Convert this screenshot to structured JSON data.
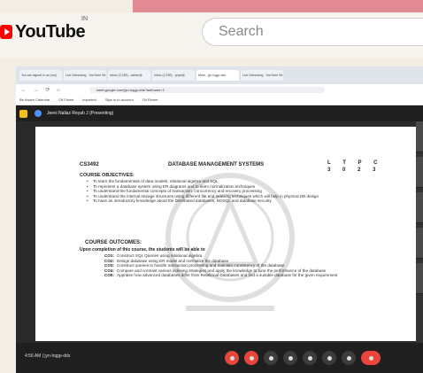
{
  "youtube": {
    "wordmark": "YouTube",
    "country": "IN",
    "search_placeholder": "Search"
  },
  "browser": {
    "tabs": [
      "You are signed in as (not)",
      "Live Streaming - YouTube Str",
      "Inbox (2,189) - admin@",
      "Inbox (2,189) - priya@",
      "Meet - jyn-hqgp-dds",
      "Live Streaming - YouTube Str"
    ],
    "active_tab_index": 4,
    "url": "meet.google.com/jyn-hqgp-dds?authuser=1",
    "bookmarks": [
      "Be Aware Calendar",
      "Oil Flowe",
      "Imported",
      "Sign in to account",
      "Oil Flower"
    ]
  },
  "meet": {
    "presenter": "Jeevi Nallaz Reyah J (Presenting)",
    "time_code": "4:56 AM  |  jyn-hqgp-dds"
  },
  "slide": {
    "course_code": "CS3492",
    "course_title": "DATABASE MANAGEMENT SYSTEMS",
    "ltpc_head": "L T P C",
    "ltpc_values": "3 0 2 3",
    "objectives_heading": "COURSE OBJECTIVES:",
    "objectives": [
      "To learn the fundamentals of data models, relational algebra and SQL",
      "To represent a database system using ER diagrams and to learn normalization techniques",
      "To understand the fundamental concepts of transaction, concurrency and recovery processing",
      "To understand the internal storage structures using different file and indexing techniques which will help in physical DB design",
      "To have an introductory knowledge about the Distributed databases, NOSQL and database security"
    ],
    "outcomes_heading": "COURSE OUTCOMES:",
    "outcomes_intro": "Upon completion of this course, the students will be able to",
    "outcomes": [
      {
        "code": "CO1:",
        "text": "Construct SQL Queries using relational algebra"
      },
      {
        "code": "CO2:",
        "text": "Design database using ER model and normalize the database"
      },
      {
        "code": "CO3:",
        "text": "Construct queries to handle transaction processing and maintain consistency of the database"
      },
      {
        "code": "CO4:",
        "text": "Compare and contrast various indexing strategies and apply the knowledge to tune the performance of the database"
      },
      {
        "code": "CO5:",
        "text": "Appraise how advanced databases differ from Relational Databases and find a suitable database for the given requirement"
      }
    ]
  },
  "colors": {
    "pink_strip": "#e28a93",
    "youtube_red": "#ff0000",
    "meet_dark": "#1f1f1f",
    "end_call_red": "#e8453c"
  }
}
